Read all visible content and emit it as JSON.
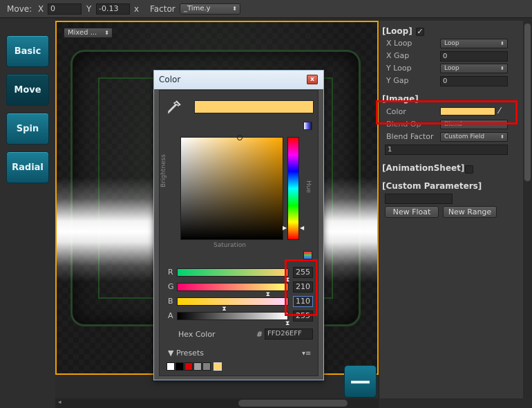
{
  "toolbar": {
    "move_label": "Move:",
    "x_label": "X",
    "x_value": "0",
    "y_label": "Y",
    "y_value": "-0.13",
    "x2_label": "x",
    "factor_label": "Factor",
    "factor_value": "_Time.y",
    "dropdown_arrow": "⬍"
  },
  "sidebar": {
    "buttons": [
      {
        "label": "Basic"
      },
      {
        "label": "Move"
      },
      {
        "label": "Spin"
      },
      {
        "label": "Radial"
      }
    ]
  },
  "game_view": {
    "mode_dropdown": "Mixed ...",
    "minus_button": "—"
  },
  "inspector": {
    "loop_section": "[Loop]",
    "loop_checked": "✓",
    "x_loop_label": "X Loop",
    "x_loop_value": "Loop",
    "x_gap_label": "X Gap",
    "x_gap_value": "0",
    "y_loop_label": "Y Loop",
    "y_loop_value": "Loop",
    "y_gap_label": "Y Gap",
    "y_gap_value": "0",
    "image_section": "[Image]",
    "color_label": "Color",
    "color_value": "#ffd26e",
    "blend_op_label": "Blend Op",
    "blend_op_value": "Blend",
    "blend_factor_label": "Blend Factor",
    "blend_factor_value": "Custom Field",
    "blend_factor_number": "1",
    "animation_section": "[AnimationSheet]",
    "custom_section": "[Custom Parameters]",
    "new_float_button": "New Float",
    "new_range_button": "New Range"
  },
  "color_dialog": {
    "title": "Color",
    "close": "x",
    "current_color": "#ffd26e",
    "brightness_label": "Brightness",
    "hue_label": "Hue",
    "saturation_label": "Saturation",
    "sliders": [
      {
        "label": "R",
        "value": "255",
        "fraction": 1.0
      },
      {
        "label": "G",
        "value": "210",
        "fraction": 0.824
      },
      {
        "label": "B",
        "value": "110",
        "fraction": 0.431
      },
      {
        "label": "A",
        "value": "255",
        "fraction": 1.0
      }
    ],
    "hex_label": "Hex Color",
    "hex_hash": "#",
    "hex_value": "FFD26EFF",
    "presets_label": "▼ Presets",
    "presets_menu": "▾≡",
    "preset_colors": [
      "#ffffff",
      "#000000",
      "#e00000",
      "#a0a0a0",
      "#808080",
      "#ffd26e"
    ],
    "saturation_fraction": 0.57,
    "brightness_fraction": 1.0,
    "hue_fraction": 0.89
  }
}
